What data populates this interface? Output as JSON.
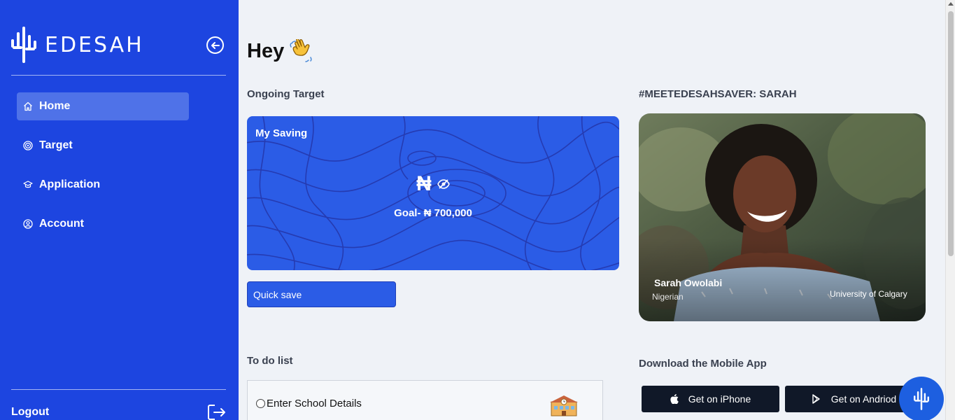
{
  "brand": {
    "name": "EDESAH"
  },
  "sidebar": {
    "items": [
      {
        "label": "Home",
        "icon": "home-icon",
        "active": true
      },
      {
        "label": "Target",
        "icon": "target-icon",
        "active": false
      },
      {
        "label": "Application",
        "icon": "graduation-cap-icon",
        "active": false
      },
      {
        "label": "Account",
        "icon": "user-circle-icon",
        "active": false
      }
    ],
    "logout_label": "Logout"
  },
  "greeting": {
    "text": "Hey",
    "emoji": "👋"
  },
  "ongoing": {
    "label": "Ongoing Target",
    "card_title": "My Saving",
    "currency": "₦",
    "goal_text": "Goal- ₦ 700,000",
    "quick_save_label": "Quick save"
  },
  "todo": {
    "label": "To do list",
    "items": [
      {
        "text": "Enter School Details",
        "icon": "school-building-icon"
      }
    ]
  },
  "saver": {
    "heading": "#MEETEDESAHSAVER: SARAH",
    "name": "Sarah Owolabi",
    "nationality": "Nigerian",
    "university": "University of Calgary"
  },
  "app_download": {
    "heading": "Download the Mobile App",
    "iphone_label": "Get on iPhone",
    "android_label": "Get on Andriod"
  },
  "colors": {
    "sidebar": "#1d45e0",
    "accent": "#2b5ce6",
    "dark_button": "#101828"
  }
}
